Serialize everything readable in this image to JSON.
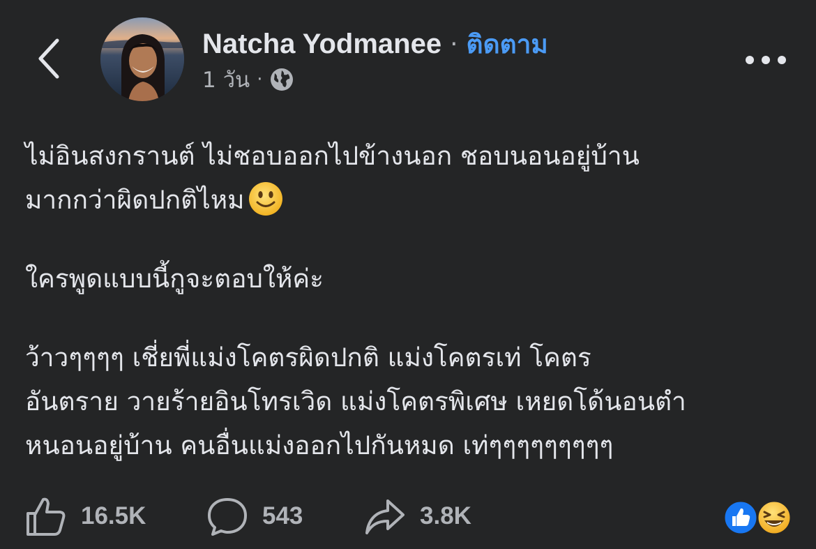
{
  "header": {
    "author_name": "Natcha Yodmanee",
    "separator": "·",
    "follow_label": "ติดตาม",
    "timestamp": "1 วัน",
    "meta_separator": "·",
    "privacy_icon": "globe-icon",
    "back_icon": "chevron-left-icon",
    "more_icon": "more-horizontal-icon"
  },
  "post": {
    "paragraph_1_line_1": "ไม่อินสงกรานต์ ไม่ชอบออกไปข้างนอก ชอบนอนอยู่บ้าน",
    "paragraph_1_line_2": "มากกว่าผิดปกติไหม",
    "paragraph_1_emoji": "slightly-smiling-face-emoji",
    "paragraph_2": "ใครพูดแบบนี้กูจะตอบให้ค่ะ",
    "paragraph_3_line_1": "ว้าวๆๆๆๆ เชี่ยพี่แม่งโคตรผิดปกติ แม่งโคตรเท่ โคตร",
    "paragraph_3_line_2": "อันตราย วายร้ายอินโทรเวิด แม่งโคตรพิเศษ เหยดโด้นอนตำ",
    "paragraph_3_line_3": "หนอนอยู่บ้าน คนอื่นแม่งออกไปกันหมด เท่ๆๆๆๆๆๆๆๆๆ"
  },
  "actions": {
    "like_count": "16.5K",
    "comment_count": "543",
    "share_count": "3.8K",
    "like_icon": "thumbs-up-icon",
    "comment_icon": "comment-bubble-icon",
    "share_icon": "share-arrow-icon"
  },
  "reactions": {
    "icons": [
      "like-reaction-icon",
      "haha-reaction-icon"
    ]
  },
  "colors": {
    "background": "#242526",
    "text_primary": "#e4e6eb",
    "text_secondary": "#b0b3b8",
    "link_blue": "#4b9bf5",
    "like_blue": "#1877f2",
    "emoji_yellow": "#f7b928"
  }
}
